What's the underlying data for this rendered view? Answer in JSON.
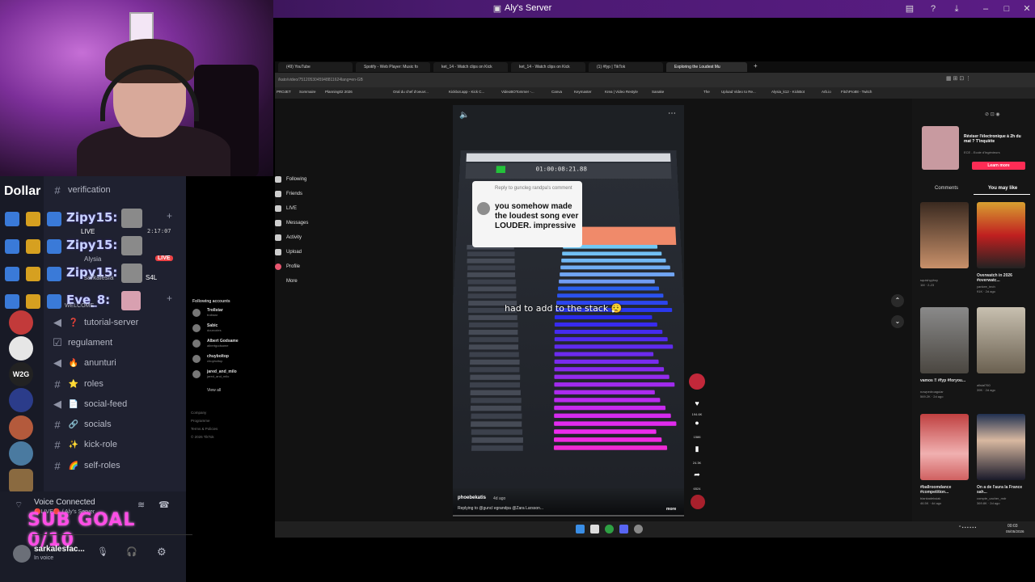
{
  "titlebar": {
    "title": "Aly's Server"
  },
  "colors": {
    "accent": "#5865f2",
    "live": "#ed4245",
    "subgoal": "#ff4de6",
    "tiktok_red": "#fe2c55"
  },
  "discord": {
    "server_name": "Dollar",
    "stream_rows": [
      {
        "name": "Zipy15:",
        "badge": "LIVE",
        "timer": "2:17:07"
      },
      {
        "name": "Zipy15:",
        "sub": "Alysia",
        "badge": "LIVE"
      },
      {
        "name": "Zipy15:",
        "sub": "sarkalesfa",
        "extra": "S4L"
      },
      {
        "name": "Eve_8:",
        "sub": "WELCOME"
      }
    ],
    "channels": [
      {
        "name": "verification",
        "icon": "hash"
      },
      {
        "name": "tutorial-server",
        "icon": "megaphone",
        "emoji": "❓"
      },
      {
        "name": "regulament",
        "icon": "rules"
      },
      {
        "name": "anunturi",
        "icon": "megaphone",
        "emoji": "🔥"
      },
      {
        "name": "roles",
        "icon": "hash",
        "emoji": "⭐"
      },
      {
        "name": "social-feed",
        "icon": "megaphone",
        "emoji": "📄"
      },
      {
        "name": "socials",
        "icon": "hash",
        "emoji": "🔗"
      },
      {
        "name": "kick-role",
        "icon": "hash",
        "emoji": "✨"
      },
      {
        "name": "self-roles",
        "icon": "hash",
        "emoji": "🌈"
      }
    ],
    "voice": {
      "status": "Voice Connected",
      "channel": "🔴LIVE🔴 / Aly's Server",
      "subgoal": "SUB GOAL 0/10"
    },
    "user": {
      "name": "sarkalesfac...",
      "status": "In voice"
    }
  },
  "browser": {
    "tabs": [
      {
        "label": "(49) YouTube"
      },
      {
        "label": "Spotify - Web Player: Music fo"
      },
      {
        "label": "ket_14 - Watch clips on Kick"
      },
      {
        "label": "ket_14 - Watch clips on Kick"
      },
      {
        "label": "(1) #fyp | TikTok"
      },
      {
        "label": "Exploring the Loudest Mu",
        "active": true
      }
    ],
    "url": "/kato/video/7512053045948811624lang=en-GB",
    "bookmarks": [
      "PROJET",
      "Sommaire",
      "Planning02 2026",
      "Oral du chef d'oeuvr...",
      "Kickbot.app - Kick C...",
      "VideoBOTommer -...",
      "Canva",
      "Keymaster",
      "Krea | Video Restyle",
      "Sanake",
      "The",
      "Upload Video to Re...",
      "Alysia_k12 - KickBot",
      "Arb.io",
      "FitchPro88 - Twitch"
    ]
  },
  "tiktok": {
    "nav": [
      "Following",
      "Friends",
      "LIVE",
      "Messages",
      "Activity",
      "Upload",
      "Profile",
      "More"
    ],
    "following_title": "Following accounts",
    "accounts": [
      {
        "name": "Trollstar",
        "handle": "trollstar"
      },
      {
        "name": "Sabic",
        "handle": "dourcotes"
      },
      {
        "name": "Albert Godsame",
        "handle": "albertgodsame"
      },
      {
        "name": "chuyboltop",
        "handle": "chuyboltop"
      },
      {
        "name": "jared_and_milo",
        "handle": "jared_and_milo"
      }
    ],
    "view_all": "View all",
    "footer": [
      "Company",
      "Programme",
      "Terms & Policies",
      "© 2026 TikTok"
    ],
    "video": {
      "comment_header": "Reply to guncleg randpa's comment",
      "comment_text": "you somehow made the loudest song ever LOUDER. impressive",
      "caption": "had to add to the stack 😮‍💨",
      "author": "phoebekatis",
      "date": "4d ago",
      "replying": "Replying to @guncl egrandpa @Zara Larsson...",
      "more": "more",
      "daw_time": "01:00:08:21.88"
    },
    "actions": [
      {
        "icon": "heart-icon",
        "count": "194.6K"
      },
      {
        "icon": "comment-icon",
        "count": "1586"
      },
      {
        "icon": "bookmark-icon",
        "count": "24.3K"
      },
      {
        "icon": "share-icon",
        "count": "6524"
      }
    ],
    "side_tabs": [
      "Comments",
      "You may like"
    ],
    "ad": {
      "title": "Réviser l'électronique à 2h du mat ? T'inquiète",
      "sub": "ECE - Ecole d'Ingénieurs",
      "button": "Learn more"
    },
    "side_videos": [
      {
        "caption": "",
        "user": "squishyyboy",
        "meta": "1M · 2-23"
      },
      {
        "caption": "Overwatch in 2026 #overwatc...",
        "user": "yankee_tech",
        "meta": "91K · 2d ago"
      },
      {
        "caption": "vamos !! #fyp #foryou...",
        "user": "nowpedroaguiar",
        "meta": "569.2K · 2d ago"
      },
      {
        "caption": "",
        "user": "allsial760",
        "meta": "39K · 2d ago"
      },
      {
        "caption": "#ballroomdance #competition...",
        "user": "blankadeksiak",
        "meta": "46.5K · 4d ago"
      },
      {
        "caption": "On a de l'aura la France sah...",
        "user": "compte_cacher_mdr",
        "meta": "369.8K · 2d ago"
      }
    ]
  },
  "taskbar": {
    "time": "00:03",
    "date": "05/05/2026"
  }
}
